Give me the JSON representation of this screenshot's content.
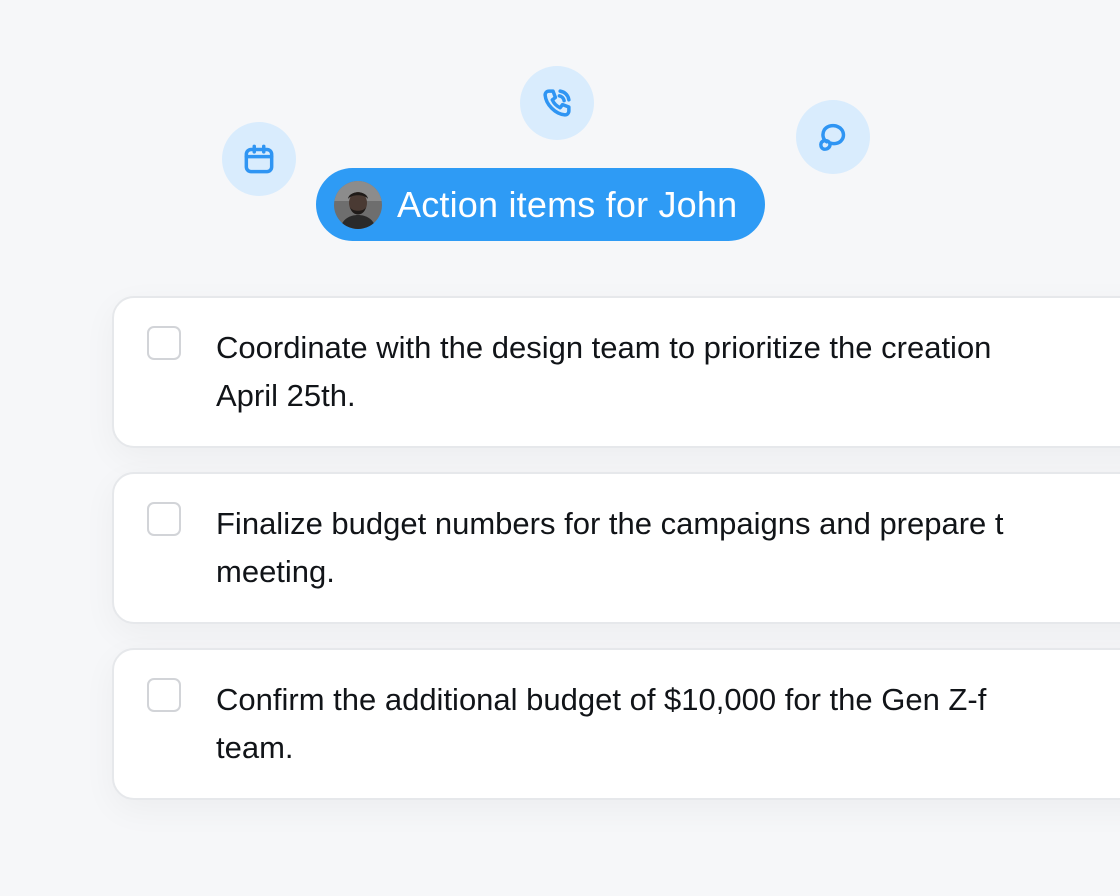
{
  "header": {
    "title": "Action items for John",
    "avatar_alt": "John"
  },
  "floating_icons": [
    "calendar-icon",
    "phone-icon",
    "chat-icon"
  ],
  "colors": {
    "accent": "#2e9bf5",
    "icon_bubble": "#d9ecfd",
    "icon_stroke": "#2f95f3",
    "background": "#f6f7f9"
  },
  "tasks": [
    {
      "line1": "Coordinate with the design team to prioritize the creation",
      "line2": "April 25th.",
      "checked": false
    },
    {
      "line1": "Finalize budget numbers for the campaigns and prepare t",
      "line2": "meeting.",
      "checked": false
    },
    {
      "line1": "Confirm the additional budget of $10,000 for the Gen Z-f",
      "line2": "team.",
      "checked": false
    }
  ]
}
